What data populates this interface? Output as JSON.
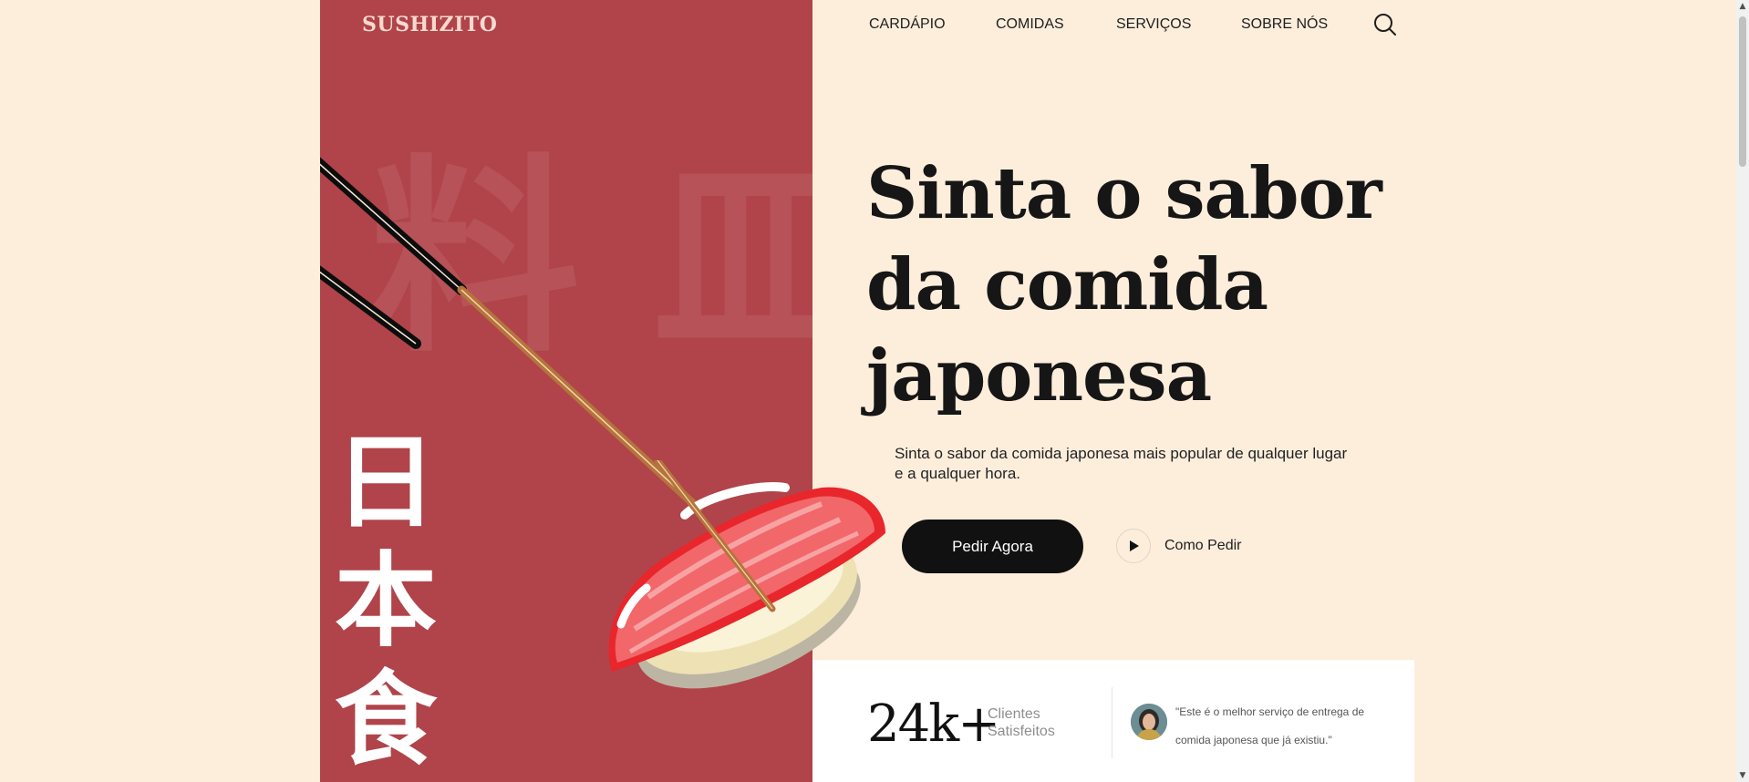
{
  "brand": {
    "logo": "SUSHIZITO"
  },
  "nav": {
    "items": [
      {
        "label": "CARDÁPIO"
      },
      {
        "label": "COMIDAS"
      },
      {
        "label": "SERVIÇOS"
      },
      {
        "label": "SOBRE NÓS"
      }
    ],
    "search_icon": "search-icon"
  },
  "hero": {
    "headline_lines": [
      "Sinta o sabor",
      "da comida",
      "japonesa"
    ],
    "subtitle": "Sinta o sabor da comida japonesa mais popular de qualquer lugar e a qualquer hora.",
    "cta_primary": "Pedir Agora",
    "cta_secondary": "Como Pedir",
    "cta_secondary_icon": "play-icon",
    "vertical_kanji": [
      "日",
      "本",
      "食"
    ],
    "background_kanji": "料 皿"
  },
  "stats": {
    "value": "24k+",
    "label": "Clientes Satisfeitos"
  },
  "testimonial": {
    "quote": "\"Este é o melhor serviço de entrega de comida japonesa que já existiu.\""
  },
  "colors": {
    "background": "#fdeedc",
    "panel_red": "#b0444a",
    "button_dark": "#111111",
    "card_white": "#ffffff"
  }
}
